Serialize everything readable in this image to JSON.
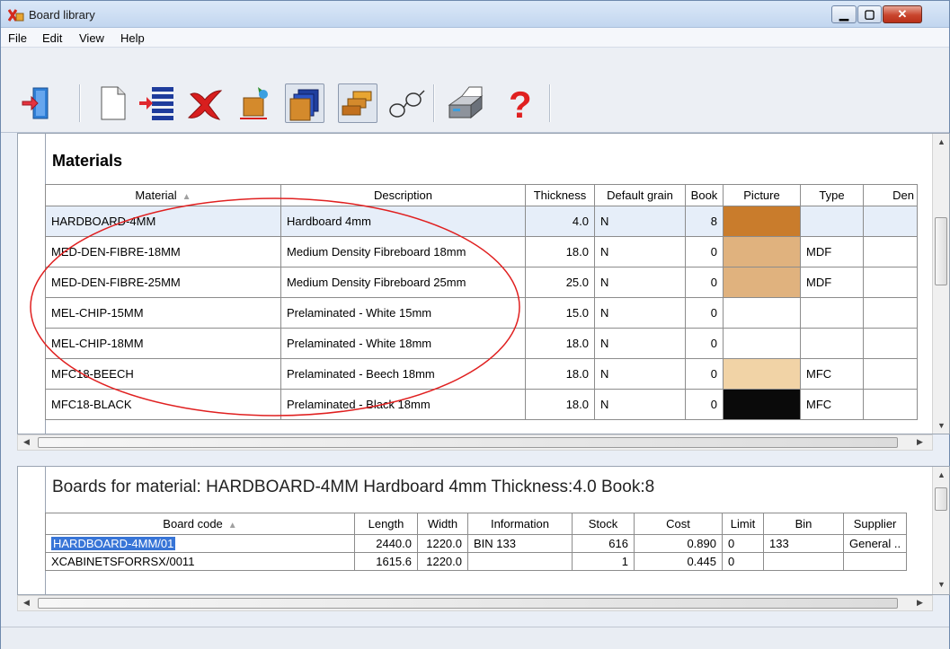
{
  "window": {
    "title": "Board library"
  },
  "menu": [
    "File",
    "Edit",
    "View",
    "Help"
  ],
  "toolbar": {
    "buttons": [
      "exit",
      "new",
      "insert-rows",
      "delete",
      "board-settings",
      "materials-view",
      "boards-view",
      "find",
      "print",
      "help"
    ]
  },
  "materials": {
    "heading": "Materials",
    "columns": [
      "Material",
      "Description",
      "Thickness",
      "Default grain",
      "Book",
      "Picture",
      "Type",
      "Den"
    ],
    "rows": [
      {
        "material": "HARDBOARD-4MM",
        "description": "Hardboard 4mm",
        "thickness": "4.0",
        "grain": "N",
        "book": "8",
        "picture": "#c97c2c",
        "type": ""
      },
      {
        "material": "MED-DEN-FIBRE-18MM",
        "description": "Medium Density Fibreboard 18mm",
        "thickness": "18.0",
        "grain": "N",
        "book": "0",
        "picture": "#e0b27e",
        "type": "MDF"
      },
      {
        "material": "MED-DEN-FIBRE-25MM",
        "description": "Medium Density Fibreboard 25mm",
        "thickness": "25.0",
        "grain": "N",
        "book": "0",
        "picture": "#e0b27e",
        "type": "MDF"
      },
      {
        "material": "MEL-CHIP-15MM",
        "description": "Prelaminated - White 15mm",
        "thickness": "15.0",
        "grain": "N",
        "book": "0",
        "picture": "",
        "type": ""
      },
      {
        "material": "MEL-CHIP-18MM",
        "description": "Prelaminated - White 18mm",
        "thickness": "18.0",
        "grain": "N",
        "book": "0",
        "picture": "",
        "type": ""
      },
      {
        "material": "MFC18-BEECH",
        "description": "Prelaminated - Beech 18mm",
        "thickness": "18.0",
        "grain": "N",
        "book": "0",
        "picture": "#f1d3a6",
        "type": "MFC"
      },
      {
        "material": "MFC18-BLACK",
        "description": "Prelaminated - Black 18mm",
        "thickness": "18.0",
        "grain": "N",
        "book": "0",
        "picture": "#0a0a0a",
        "type": "MFC"
      }
    ]
  },
  "boards": {
    "heading": "Boards for material: HARDBOARD-4MM Hardboard 4mm Thickness:4.0 Book:8",
    "columns": [
      "Board code",
      "Length",
      "Width",
      "Information",
      "Stock",
      "Cost",
      "Limit",
      "Bin",
      "Supplier"
    ],
    "rows": [
      {
        "code": "HARDBOARD-4MM/01",
        "length": "2440.0",
        "width": "1220.0",
        "info": "BIN 133",
        "stock": "616",
        "cost": "0.890",
        "limit": "0",
        "bin": "133",
        "supplier": "General .."
      },
      {
        "code": "XCABINETSFORRSX/0011",
        "length": "1615.6",
        "width": "1220.0",
        "info": "",
        "stock": "1",
        "cost": "0.445",
        "limit": "0",
        "bin": "",
        "supplier": ""
      }
    ]
  },
  "colors": {
    "selection": "#3875d7",
    "annotation": "#e02020"
  }
}
